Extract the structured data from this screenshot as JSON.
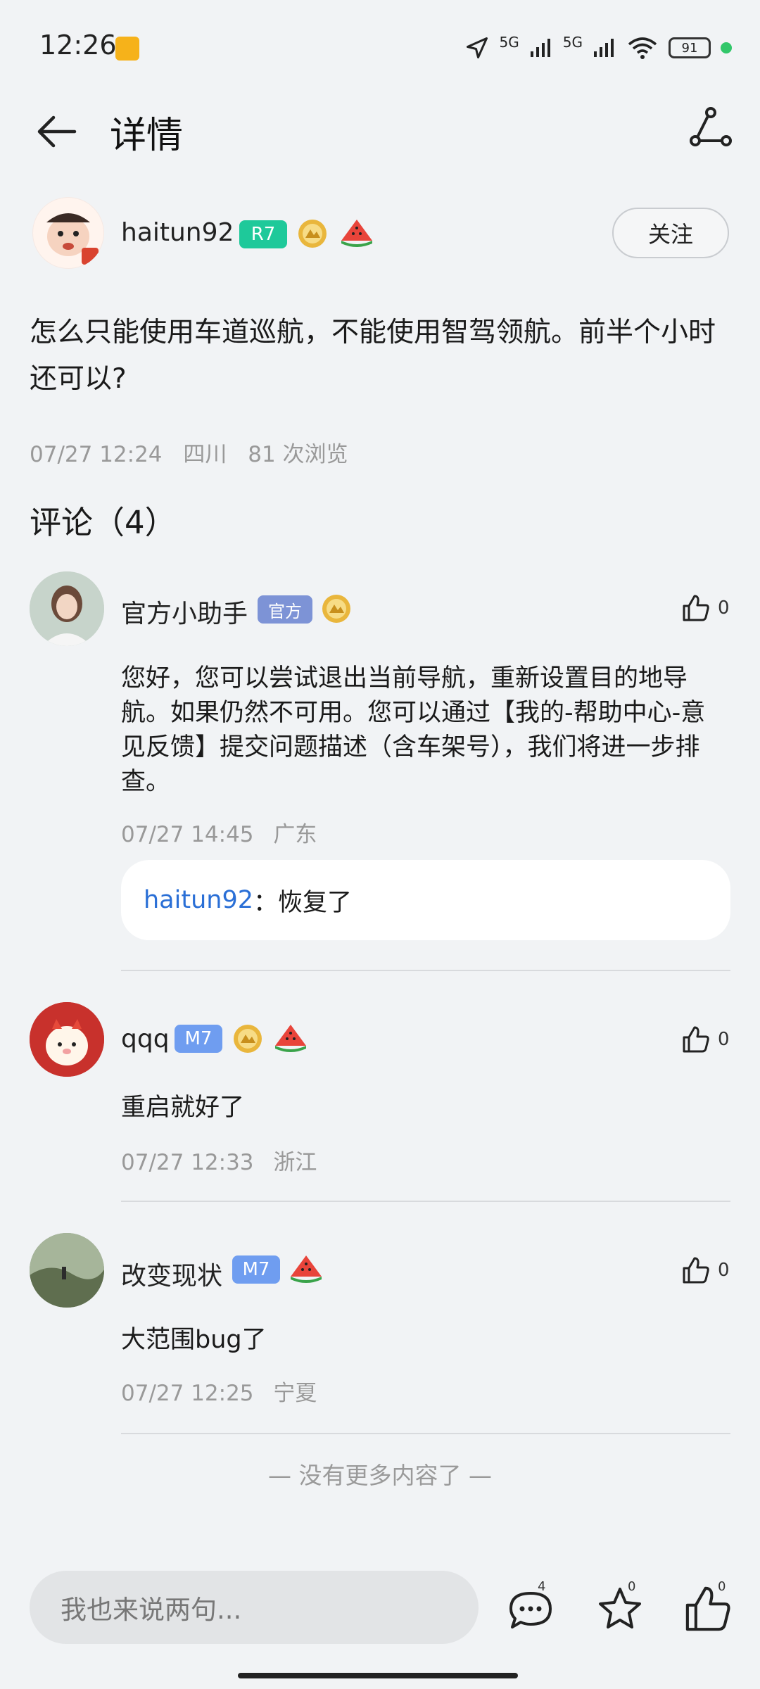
{
  "status_bar": {
    "time": "12:26",
    "signal1": "5G",
    "signal2": "5G",
    "battery": "91"
  },
  "header": {
    "title": "详情"
  },
  "post": {
    "author": {
      "name": "haitun92",
      "level_badge": "R7"
    },
    "follow_label": "关注",
    "content": "怎么只能使用车道巡航，不能使用智驾领航。前半个小时还可以?",
    "date": "07/27 12:24",
    "location": "四川",
    "views": "81 次浏览"
  },
  "comments_header": "评论（4）",
  "comments": [
    {
      "name": "官方小助手",
      "badge": "官方",
      "likes": "0",
      "text": "您好，您可以尝试退出当前导航，重新设置目的地导航。如果仍然不可用。您可以通过【我的-帮助中心-意见反馈】提交问题描述（含车架号），我们将进一步排查。",
      "date": "07/27 14:45",
      "location": "广东",
      "reply": {
        "user": "haitun92",
        "sep": "：",
        "text": "恢复了"
      }
    },
    {
      "name": "qqq",
      "badge": "M7",
      "likes": "0",
      "text": "重启就好了",
      "date": "07/27 12:33",
      "location": "浙江"
    },
    {
      "name": "改变现状",
      "badge": "M7",
      "likes": "0",
      "text": "大范围bug了",
      "date": "07/27 12:25",
      "location": "宁夏"
    }
  ],
  "footer_note": "— 没有更多内容了 —",
  "bottom_bar": {
    "input_placeholder": "我也来说两句...",
    "comment_count": "4",
    "favorite_count": "0",
    "like_count": "0"
  }
}
